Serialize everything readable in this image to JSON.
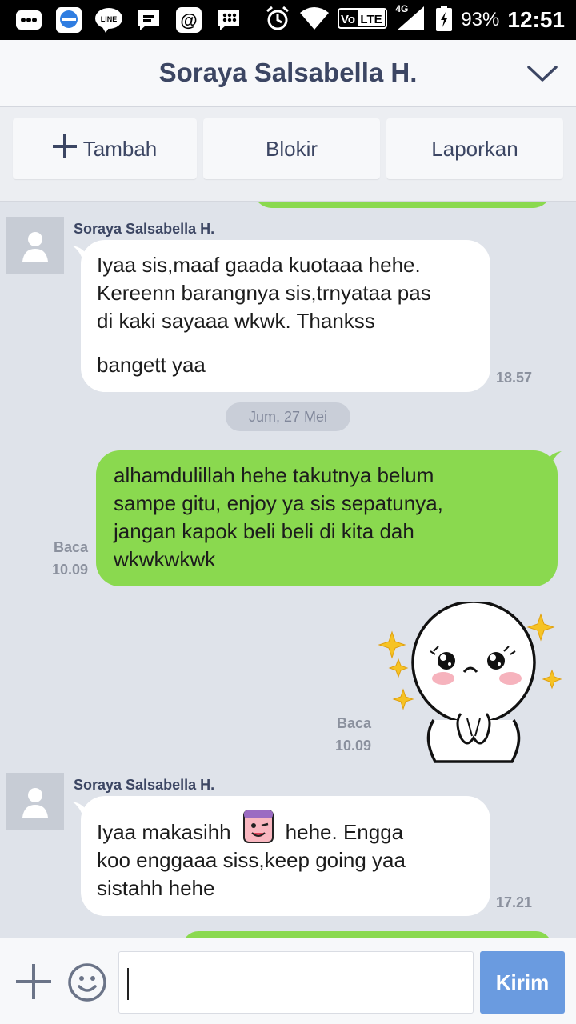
{
  "status_bar": {
    "icons": [
      "more-dots-icon",
      "browser-icon",
      "line-app-icon",
      "chat-icon",
      "mail-at-icon",
      "bbm-icon",
      "alarm-icon",
      "wifi-icon",
      "volte-icon",
      "signal-4g-icon",
      "battery-icon"
    ],
    "volte": "VoLTE",
    "network": "4G",
    "battery": "93%",
    "time": "12:51"
  },
  "header": {
    "title": "Soraya Salsabella H.",
    "menu_icon": "chevron-down-icon"
  },
  "actions": {
    "add_label": "Tambah",
    "block_label": "Blokir",
    "report_label": "Laporkan"
  },
  "messages": [
    {
      "sender": "Soraya Salsabella H.",
      "lines": [
        "Iyaa sis,maaf gaada kuotaaa hehe.",
        "Kereenn barangnya sis,trnyataa pas",
        "di kaki sayaaa wkwk. Thankss",
        "bangett yaa"
      ],
      "time": "18.57"
    },
    {
      "date": "Jum, 27 Mei"
    },
    {
      "lines": [
        "alhamdulillah hehe takutnya belum",
        "sampe gitu, enjoy ya sis sepatunya,",
        "jangan kapok beli beli di kita dah",
        "wkwkwkwk"
      ],
      "read": "Baca",
      "time": "10.09"
    },
    {
      "sticker": "crying-face-sticker",
      "read": "Baca",
      "time": "10.09"
    },
    {
      "sender": "Soraya Salsabella H.",
      "line1_before": "Iyaa makasihh",
      "emoji": "winking-emoji",
      "line1_after": "hehe. Engga",
      "lines_rest": [
        "koo enggaaa siss,keep going yaa",
        "sistahh hehe"
      ],
      "time": "17.21"
    }
  ],
  "composer": {
    "send_label": "Kirim",
    "input_value": ""
  },
  "colors": {
    "outgoing_bubble": "#8ad94f",
    "incoming_bubble": "#ffffff",
    "chat_background": "#dfe3ea",
    "header_text": "#3c4663",
    "send_button": "#6a9be0"
  }
}
